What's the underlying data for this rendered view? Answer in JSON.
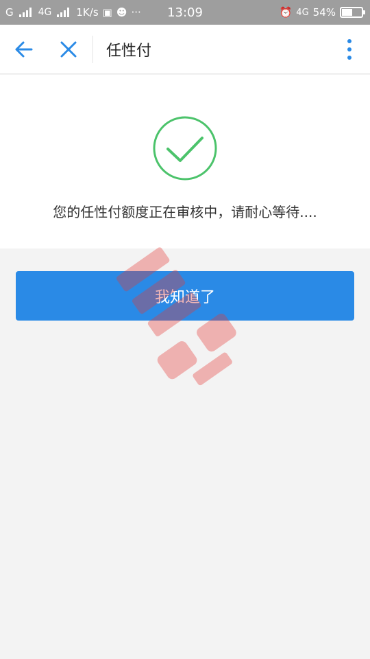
{
  "status_bar": {
    "carrier1": "G",
    "carrier2": "4G",
    "net_speed": "1K/s",
    "more": "···",
    "time": "13:09",
    "network_type": "4G",
    "battery_percent": "54%",
    "battery_level": 0.54
  },
  "nav": {
    "title": "任性付"
  },
  "result": {
    "message": "您的任性付额度正在审核中，请耐心等待...."
  },
  "actions": {
    "confirm_label": "我知道了"
  },
  "colors": {
    "accent": "#2a8ae6",
    "success": "#4cc36b",
    "nav_icon": "#2a8ae6"
  }
}
